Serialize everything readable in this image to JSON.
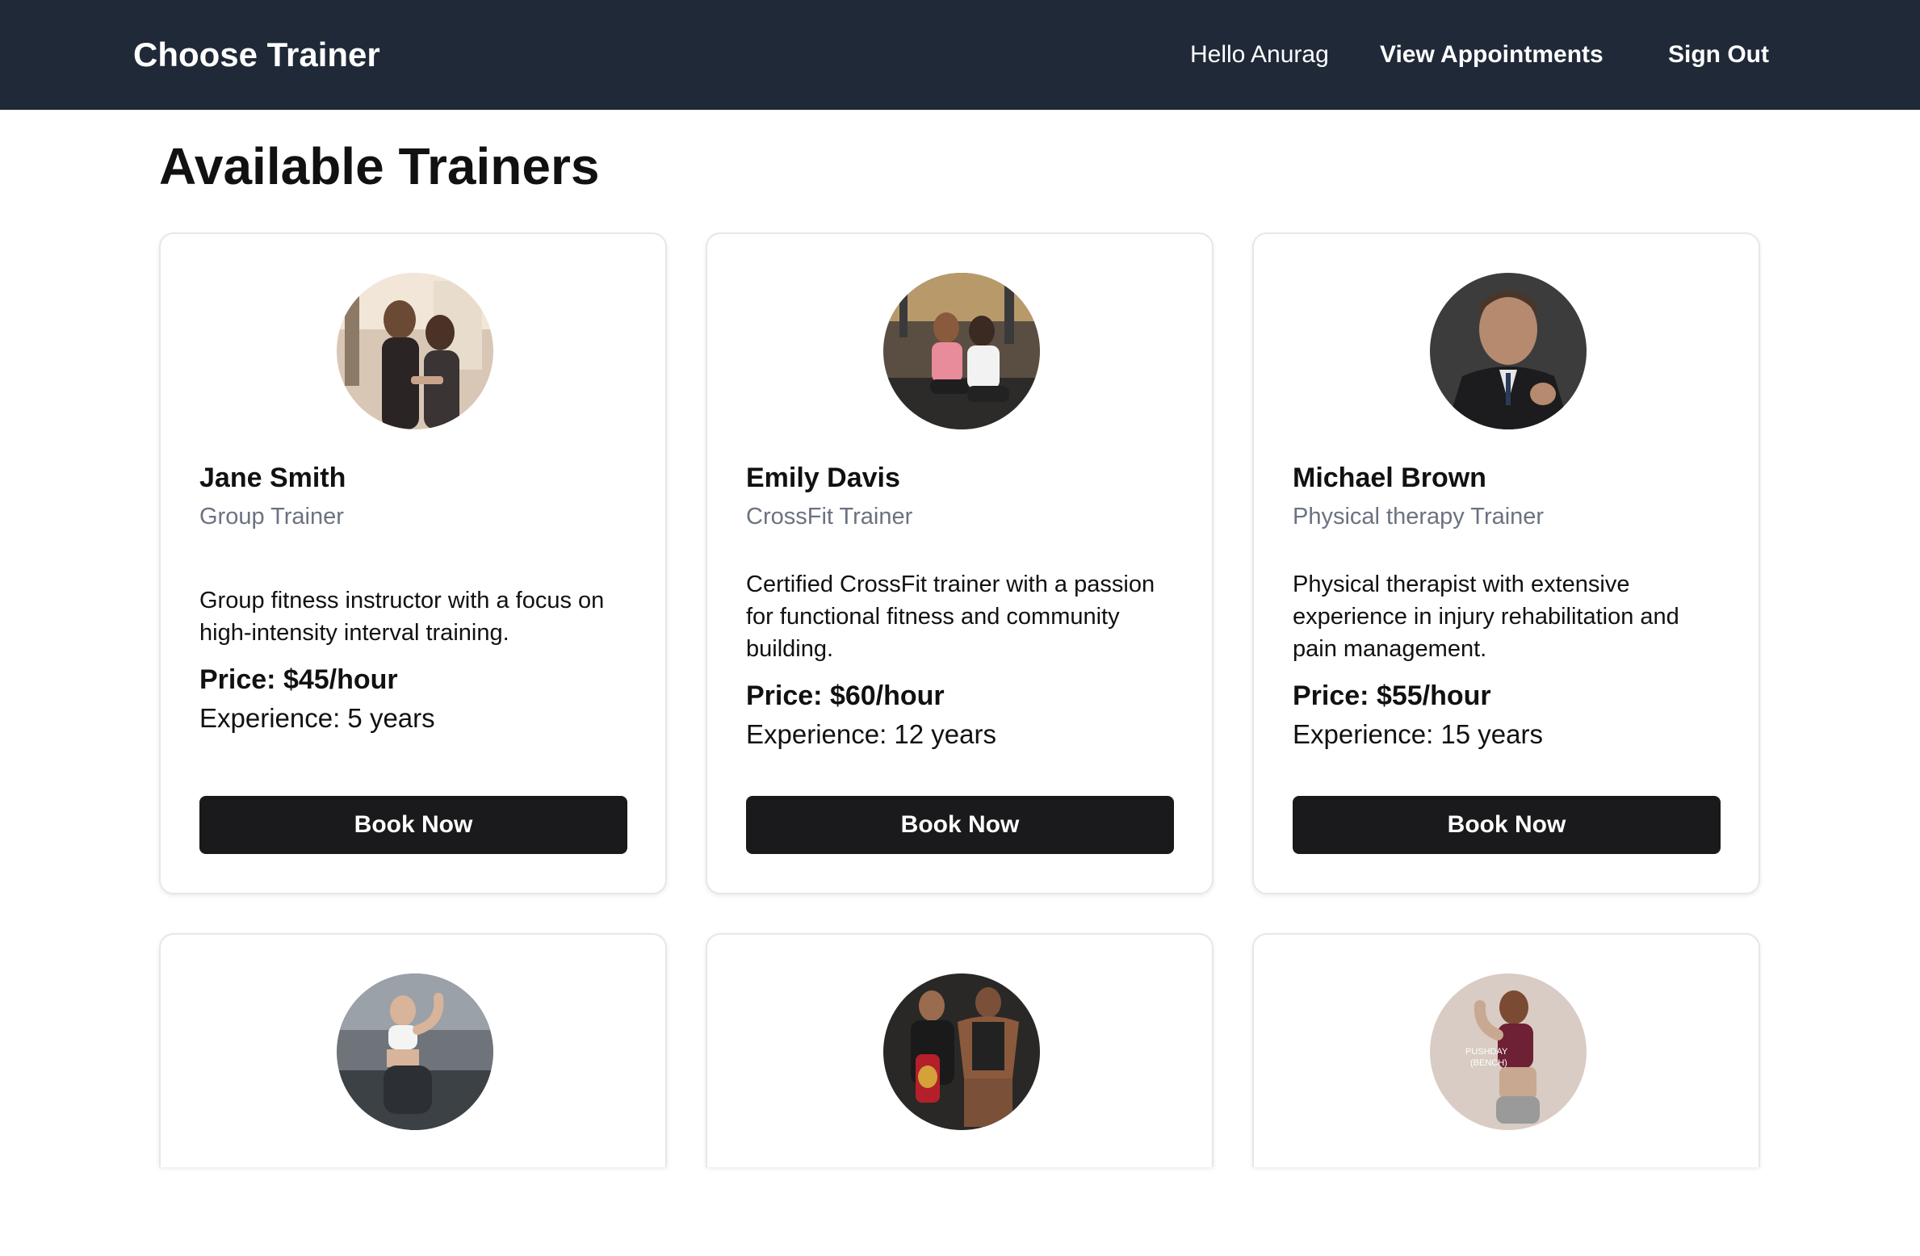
{
  "header": {
    "brand": "Choose Trainer",
    "hello": "Hello Anurag",
    "view_appointments": "View Appointments",
    "sign_out": "Sign Out",
    "background": "#1f2937"
  },
  "page_title": "Available Trainers",
  "trainers": [
    {
      "name": "Jane Smith",
      "role": "Group Trainer",
      "description": "Group fitness instructor with a focus on high-intensity interval training.",
      "price": "Price: $45/hour",
      "experience": "Experience: 5 years",
      "button": "Book Now",
      "photo": "trainer-photo-two-women-gym"
    },
    {
      "name": "Emily Davis",
      "role": "CrossFit Trainer",
      "description": "Certified CrossFit trainer with a passion for functional fitness and community building.",
      "price": "Price: $60/hour",
      "experience": "Experience: 12 years",
      "button": "Book Now",
      "photo": "trainer-photo-two-people-gym-floor"
    },
    {
      "name": "Michael Brown",
      "role": "Physical therapy Trainer",
      "description": "Physical therapist with extensive experience in injury rehabilitation and pain management.",
      "price": "Price: $55/hour",
      "experience": "Experience: 15 years",
      "button": "Book Now",
      "photo": "trainer-photo-man-in-suit"
    },
    {
      "photo": "trainer-photo-woman-flexing-gym"
    },
    {
      "photo": "trainer-photo-bodybuilders-belt"
    },
    {
      "photo": "trainer-photo-woman-flexing",
      "photo_text": "PUSHDAY (BENCH)"
    }
  ],
  "colors": {
    "button": "#1a1a1c",
    "role_text": "#6b7280",
    "card_border": "#e5e7eb"
  }
}
